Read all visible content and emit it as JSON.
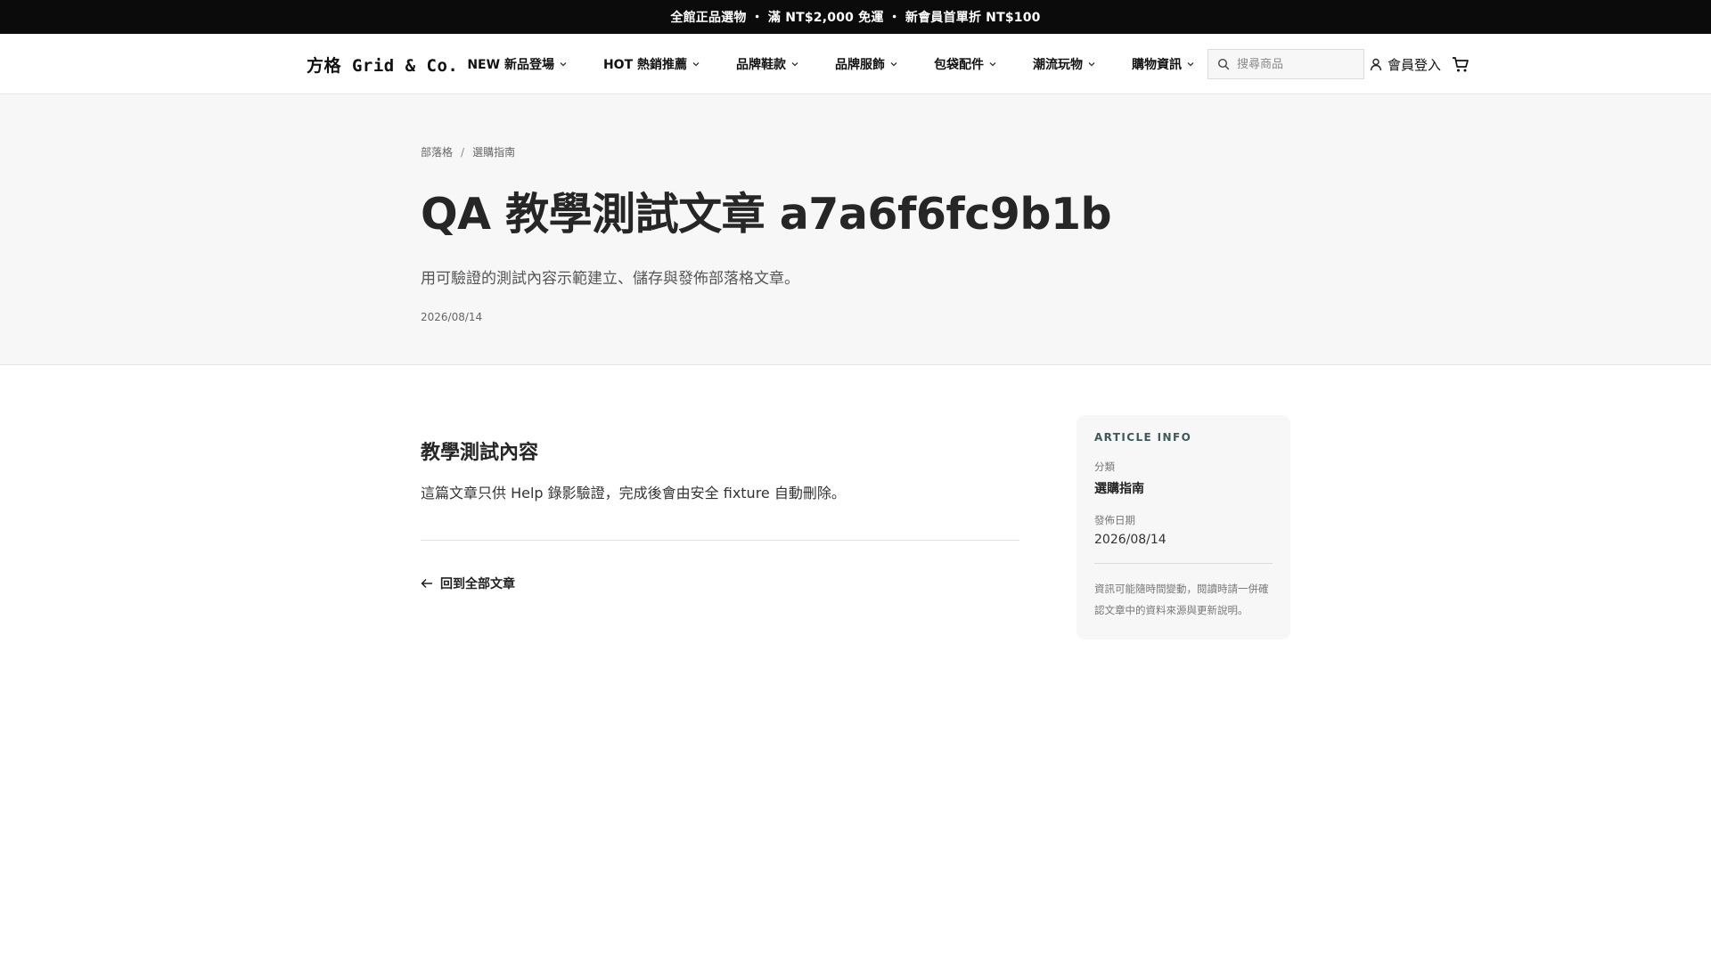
{
  "announcement": "全館正品選物 ・ 滿 NT$2,000 免運 ・ 新會員首單折 NT$100",
  "header": {
    "logo": "方格 Grid & Co.",
    "nav": [
      {
        "label": "NEW 新品登場"
      },
      {
        "label": "HOT 熱銷推薦"
      },
      {
        "label": "品牌鞋款"
      },
      {
        "label": "品牌服飾"
      },
      {
        "label": "包袋配件"
      },
      {
        "label": "潮流玩物"
      },
      {
        "label": "購物資訊"
      }
    ],
    "search_placeholder": "搜尋商品",
    "login_label": "會員登入",
    "icons": {
      "search": "search-icon",
      "user": "user-icon",
      "cart": "cart-icon",
      "chevron": "chevron-down-icon"
    }
  },
  "hero": {
    "breadcrumb": [
      "部落格",
      "選購指南"
    ],
    "breadcrumb_separator": "/",
    "title": "QA 教學測試文章 a7a6f6fc9b1b",
    "subtitle": "用可驗證的測試內容示範建立、儲存與發佈部落格文章。",
    "date": "2026/08/14"
  },
  "article": {
    "heading": "教學測試內容",
    "body": "這篇文章只供 Help 錄影驗證，完成後會由安全 fixture 自動刪除。",
    "back_label": "回到全部文章"
  },
  "info": {
    "heading": "ARTICLE INFO",
    "category_label": "分類",
    "category_value": "選購指南",
    "date_label": "發佈日期",
    "date_value": "2026/08/14",
    "note": "資訊可能隨時間變動，閱讀時請一併確認文章中的資料來源與更新說明。"
  },
  "colors": {
    "announcement_bg": "#0b0b0b",
    "hero_bg": "#f7f7f7",
    "info_heading": "#3c5a5a"
  }
}
